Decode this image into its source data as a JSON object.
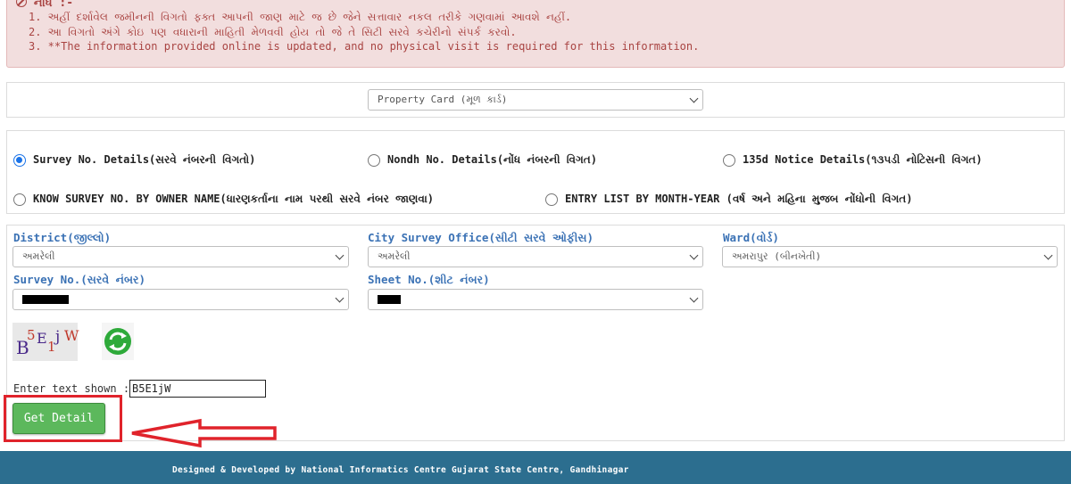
{
  "notice": {
    "title": "નોંધ :-",
    "items": [
      "1. અહીં દર્શાવેલ જમીનની વિગતો ફક્ત આપની જાણ માટે જ છે જેને સત્તાવાર નકલ તરીકે ગણવામાં આવશે નહીં.",
      "2. આ વિગતો અંગે કોઇ પણ વધારાની માહિતી મેળવવી હોય તો જે તે સિટી સરવે કચેરીનો સંપર્ક કરવો.",
      "3. **The information provided online is updated, and no physical visit is required for this information."
    ]
  },
  "card_type": {
    "selected": "Property Card (મૂળ કાર્ડ)"
  },
  "search_options": [
    {
      "label": "Survey No. Details(સરવે નંબરની વિગતો)",
      "checked": true
    },
    {
      "label": "Nondh No. Details(નોંધ નંબરની વિગત)",
      "checked": false
    },
    {
      "label": "135d Notice Details(૧૩૫ડી નોટિસની વિગત)",
      "checked": false
    },
    {
      "label": "KNOW SURVEY NO. BY OWNER NAME(ધારણકર્તાના નામ પરથી સરવે નંબર જાણવા)",
      "checked": false
    },
    {
      "label": "ENTRY LIST BY MONTH-YEAR (વર્ષ અને મહિના મુજબ નોંધોની વિગત)",
      "checked": false
    }
  ],
  "form": {
    "district": {
      "label": "District(જીલ્લો)",
      "value": "અમરેલી"
    },
    "city_survey_office": {
      "label": "City Survey Office(સીટી સરવે ઓફીસ)",
      "value": "અમરેલી"
    },
    "ward": {
      "label": "Ward(વોર્ડ)",
      "value": "અમરાપુર (બીનખેતી)"
    },
    "survey_no": {
      "label": "Survey No.(સરવે નંબર)",
      "value": ""
    },
    "sheet_no": {
      "label": "Sheet No.(શીટ નંબર)",
      "value": ""
    }
  },
  "captcha": {
    "chars": [
      "B",
      "5",
      "E",
      "1",
      "j",
      "W"
    ],
    "input_label": "Enter text shown :",
    "input_value": "B5E1jW"
  },
  "submit_label": "Get Detail",
  "footer_text": "Designed & Developed by National Informatics Centre Gujarat State Centre, Gandhinagar",
  "colors": {
    "accent_red": "#e0232b",
    "button_green": "#5cb85c",
    "footer_bg": "#2c6e8f",
    "label_blue": "#3b72b5"
  }
}
